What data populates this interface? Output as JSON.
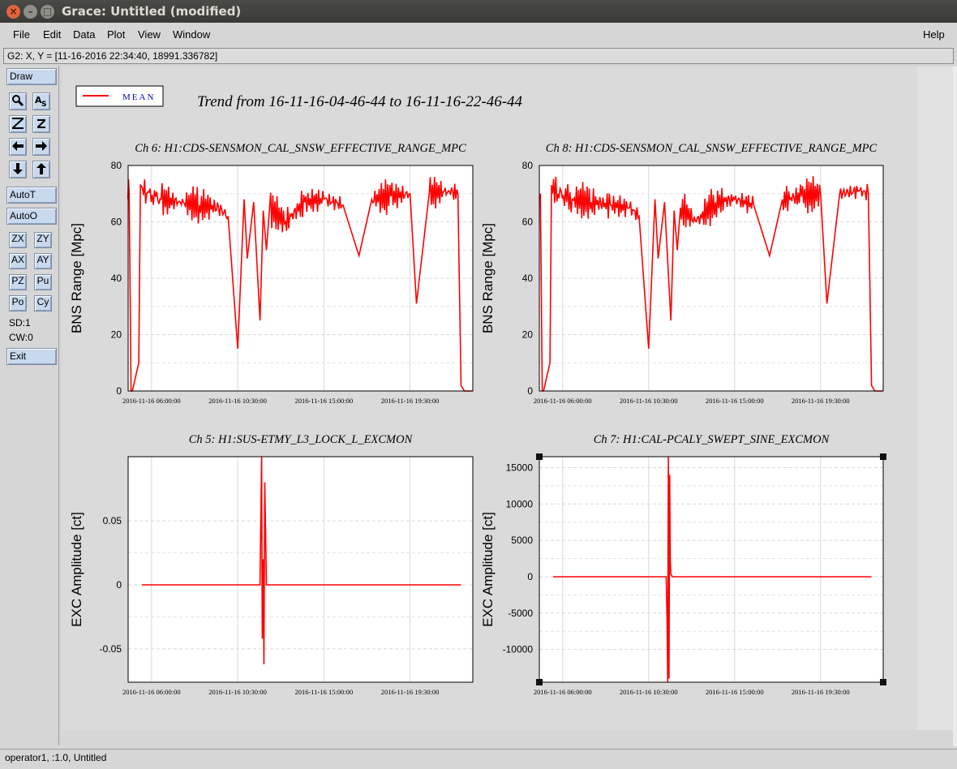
{
  "window": {
    "title": "Grace: Untitled (modified)",
    "close_glyph": "×",
    "min_glyph": "–",
    "max_glyph": "□"
  },
  "menubar": {
    "items": [
      "File",
      "Edit",
      "Data",
      "Plot",
      "View",
      "Window"
    ],
    "help": "Help"
  },
  "location": "G2: X, Y = [11-16-2016 22:34:40, 18991.336782]",
  "toolbar": {
    "draw": "Draw",
    "autot": "AutoT",
    "autoo": "AutoO",
    "zx": "ZX",
    "zy": "ZY",
    "ax": "AX",
    "ay": "AY",
    "pz": "PZ",
    "pu": "Pu",
    "po": "Po",
    "cy": "Cy",
    "sd": "SD:1",
    "cw": "CW:0",
    "exit": "Exit",
    "icons": [
      "zoom-icon",
      "autoscale-text-icon",
      "zoom-z-large-icon",
      "zoom-z-small-icon",
      "left-arrow-icon",
      "right-arrow-icon",
      "down-arrow-icon",
      "up-arrow-icon"
    ]
  },
  "status": "operator1, :1.0, Untitled",
  "colors": {
    "series": "#ff0000",
    "legend_text": "#0000cc"
  },
  "chart_data": [
    {
      "type": "line",
      "title": "Ch 6: H1:CDS-SENSMON_CAL_SNSW_EFFECTIVE_RANGE_MPC",
      "ylabel": "BNS Range [Mpc]",
      "xlabel": "",
      "x_ticks": [
        "2016-11-16 06:00:00",
        "2016-11-16 10:30:00",
        "2016-11-16 15:00:00",
        "2016-11-16 19:30:00"
      ],
      "y_ticks": [
        "0",
        "20",
        "40",
        "60",
        "80"
      ],
      "xlim": [
        "2016-11-16 04:46:44",
        "2016-11-16 22:46:44"
      ],
      "ylim": [
        0,
        80
      ],
      "grid": true,
      "series": [
        {
          "name": "MEAN",
          "x": [
            "04:46",
            "04:50",
            "04:56",
            "05:00",
            "05:20",
            "05:25",
            "05:45",
            "06:30",
            "07:30",
            "08:30",
            "09:30",
            "10:00",
            "10:30",
            "10:50",
            "11:00",
            "11:20",
            "11:40",
            "11:50",
            "12:00",
            "12:10",
            "13:00",
            "14:00",
            "15:00",
            "16:00",
            "16:50",
            "17:30",
            "18:30",
            "19:30",
            "19:50",
            "20:30",
            "21:30",
            "22:00",
            "22:10",
            "22:20",
            "22:46"
          ],
          "values": [
            68,
            70,
            0,
            0,
            10,
            73,
            70,
            68,
            67,
            66,
            65,
            62,
            15,
            68,
            47,
            67,
            25,
            64,
            50,
            65,
            60,
            67,
            68,
            66,
            48,
            68,
            69,
            70,
            31,
            70,
            71,
            70,
            2,
            0,
            0
          ]
        }
      ]
    },
    {
      "type": "line",
      "title": "Ch 8: H1:CDS-SENSMON_CAL_SNSW_EFFECTIVE_RANGE_MPC",
      "ylabel": "BNS Range [Mpc]",
      "xlabel": "",
      "x_ticks": [
        "2016-11-16 06:00:00",
        "2016-11-16 10:30:00",
        "2016-11-16 15:00:00",
        "2016-11-16 19:30:00"
      ],
      "y_ticks": [
        "0",
        "20",
        "40",
        "60",
        "80"
      ],
      "xlim": [
        "2016-11-16 04:46:44",
        "2016-11-16 22:46:44"
      ],
      "ylim": [
        0,
        80
      ],
      "grid": true,
      "series": [
        {
          "name": "MEAN",
          "x": [
            "04:46",
            "04:50",
            "04:56",
            "05:00",
            "05:20",
            "05:25",
            "05:45",
            "06:30",
            "07:30",
            "08:30",
            "09:30",
            "10:00",
            "10:30",
            "10:50",
            "11:00",
            "11:20",
            "11:40",
            "11:50",
            "12:00",
            "12:10",
            "13:00",
            "14:00",
            "15:00",
            "16:00",
            "16:50",
            "17:30",
            "18:30",
            "19:30",
            "19:50",
            "20:30",
            "21:30",
            "22:00",
            "22:10",
            "22:20",
            "22:46"
          ],
          "values": [
            68,
            70,
            0,
            0,
            10,
            73,
            70,
            68,
            67,
            66,
            65,
            62,
            15,
            68,
            47,
            67,
            25,
            64,
            50,
            65,
            60,
            67,
            68,
            66,
            48,
            68,
            69,
            70,
            31,
            70,
            71,
            70,
            2,
            0,
            0
          ]
        }
      ]
    },
    {
      "type": "line",
      "title": "Ch 5: H1:SUS-ETMY_L3_LOCK_L_EXCMON",
      "ylabel": "EXC Amplitude [ct]",
      "xlabel": "",
      "x_ticks": [
        "2016-11-16 06:00:00",
        "2016-11-16 10:30:00",
        "2016-11-16 15:00:00",
        "2016-11-16 19:30:00"
      ],
      "y_ticks": [
        "-0.05",
        "0",
        "0.05"
      ],
      "xlim": [
        "2016-11-16 04:46:44",
        "2016-11-16 22:46:44"
      ],
      "ylim": [
        -0.076,
        0.1
      ],
      "grid": true,
      "series": [
        {
          "name": "MEAN",
          "x": [
            "05:30",
            "11:40",
            "11:45",
            "11:47",
            "11:50",
            "11:52",
            "11:55",
            "12:00",
            "22:10"
          ],
          "values": [
            0,
            0,
            0.1,
            -0.042,
            0.02,
            -0.062,
            0.08,
            0,
            0
          ]
        }
      ]
    },
    {
      "type": "line",
      "title": "Ch 7: H1:CAL-PCALY_SWEPT_SINE_EXCMON",
      "ylabel": "EXC Amplitude [ct]",
      "xlabel": "",
      "x_ticks": [
        "2016-11-16 06:00:00",
        "2016-11-16 10:30:00",
        "2016-11-16 15:00:00",
        "2016-11-16 19:30:00"
      ],
      "y_ticks": [
        "-10000",
        "-5000",
        "0",
        "5000",
        "10000",
        "15000"
      ],
      "xlim": [
        "2016-11-16 04:46:44",
        "2016-11-16 22:46:44"
      ],
      "ylim": [
        -14500,
        16500
      ],
      "grid": true,
      "series": [
        {
          "name": "MEAN",
          "x": [
            "05:30",
            "11:25",
            "11:28",
            "11:30",
            "11:32",
            "11:34",
            "11:36",
            "11:38",
            "11:40",
            "11:45",
            "22:10"
          ],
          "values": [
            0,
            0,
            -6000,
            -14500,
            16500,
            -14000,
            14000,
            2000,
            300,
            0,
            0
          ]
        }
      ]
    }
  ],
  "legend": {
    "label": "MEAN"
  },
  "header_title": "Trend from 16-11-16-04-46-44 to 16-11-16-22-46-44"
}
